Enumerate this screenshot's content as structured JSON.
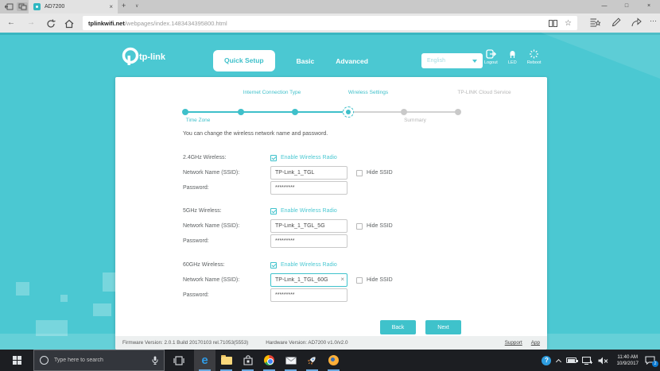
{
  "browser": {
    "tab_title": "AD7200",
    "url_host": "tplinkwifi.net",
    "url_path": "/webpages/index.1483434395800.html"
  },
  "icons": {
    "tab_close": "×",
    "new_tab": "+",
    "tab_chevron": "∨",
    "minimize": "—",
    "maximize": "□",
    "close": "×",
    "back": "←",
    "forward": "→",
    "star": "☆",
    "more": "⋯",
    "edge_logo": "e",
    "help": "?",
    "clear": "×"
  },
  "header": {
    "brand": "tp-link",
    "tabs": [
      {
        "label": "Quick Setup"
      },
      {
        "label": "Basic"
      },
      {
        "label": "Advanced"
      }
    ],
    "language": "English",
    "actions": [
      {
        "label": "Logout"
      },
      {
        "label": "LED"
      },
      {
        "label": "Reboot"
      }
    ]
  },
  "stepper": {
    "steps": [
      {
        "label": "Time Zone",
        "state": "done"
      },
      {
        "label": "Internet Connection Type",
        "state": "done"
      },
      {
        "label": "",
        "state": "done"
      },
      {
        "label": "Wireless Settings",
        "state": "current"
      },
      {
        "label": "Summary",
        "state": "upcoming"
      },
      {
        "label": "TP-LINK Cloud Service",
        "state": "upcoming"
      }
    ]
  },
  "form": {
    "intro": "You can change the wireless network name and password.",
    "sections": [
      {
        "band": "2.4GHz Wireless:",
        "enable_label": "Enable Wireless Radio",
        "ssid_label": "Network Name (SSID):",
        "ssid": "TP-Link_1_TGL",
        "hide_label": "Hide SSID",
        "password_label": "Password:",
        "password": "*********"
      },
      {
        "band": "5GHz Wireless:",
        "enable_label": "Enable Wireless Radio",
        "ssid_label": "Network Name (SSID):",
        "ssid": "TP-Link_1_TGL_5G",
        "hide_label": "Hide SSID",
        "password_label": "Password:",
        "password": "*********"
      },
      {
        "band": "60GHz Wireless:",
        "enable_label": "Enable Wireless Radio",
        "ssid_label": "Network Name (SSID):",
        "ssid": "TP-Link_1_TGL_60G",
        "hide_label": "Hide SSID",
        "password_label": "Password:",
        "password": "*********"
      }
    ],
    "back_label": "Back",
    "next_label": "Next"
  },
  "footer": {
    "firmware": "Firmware Version: 2.0.1 Build 20170103 rel.71053(5553)",
    "hardware": "Hardware Version: AD7200 v1.0/v2.0",
    "links": [
      {
        "label": "Support"
      },
      {
        "label": "App"
      }
    ]
  },
  "taskbar": {
    "search_placeholder": "Type here to search",
    "clock_time": "11:40 AM",
    "clock_date": "10/9/2017",
    "notification_count": "2"
  },
  "colors": {
    "teal": "#4bc8d2",
    "teal_accent": "#3fc0ca",
    "button": "#3fc2cb",
    "edge_blue": "#2f9be6"
  }
}
